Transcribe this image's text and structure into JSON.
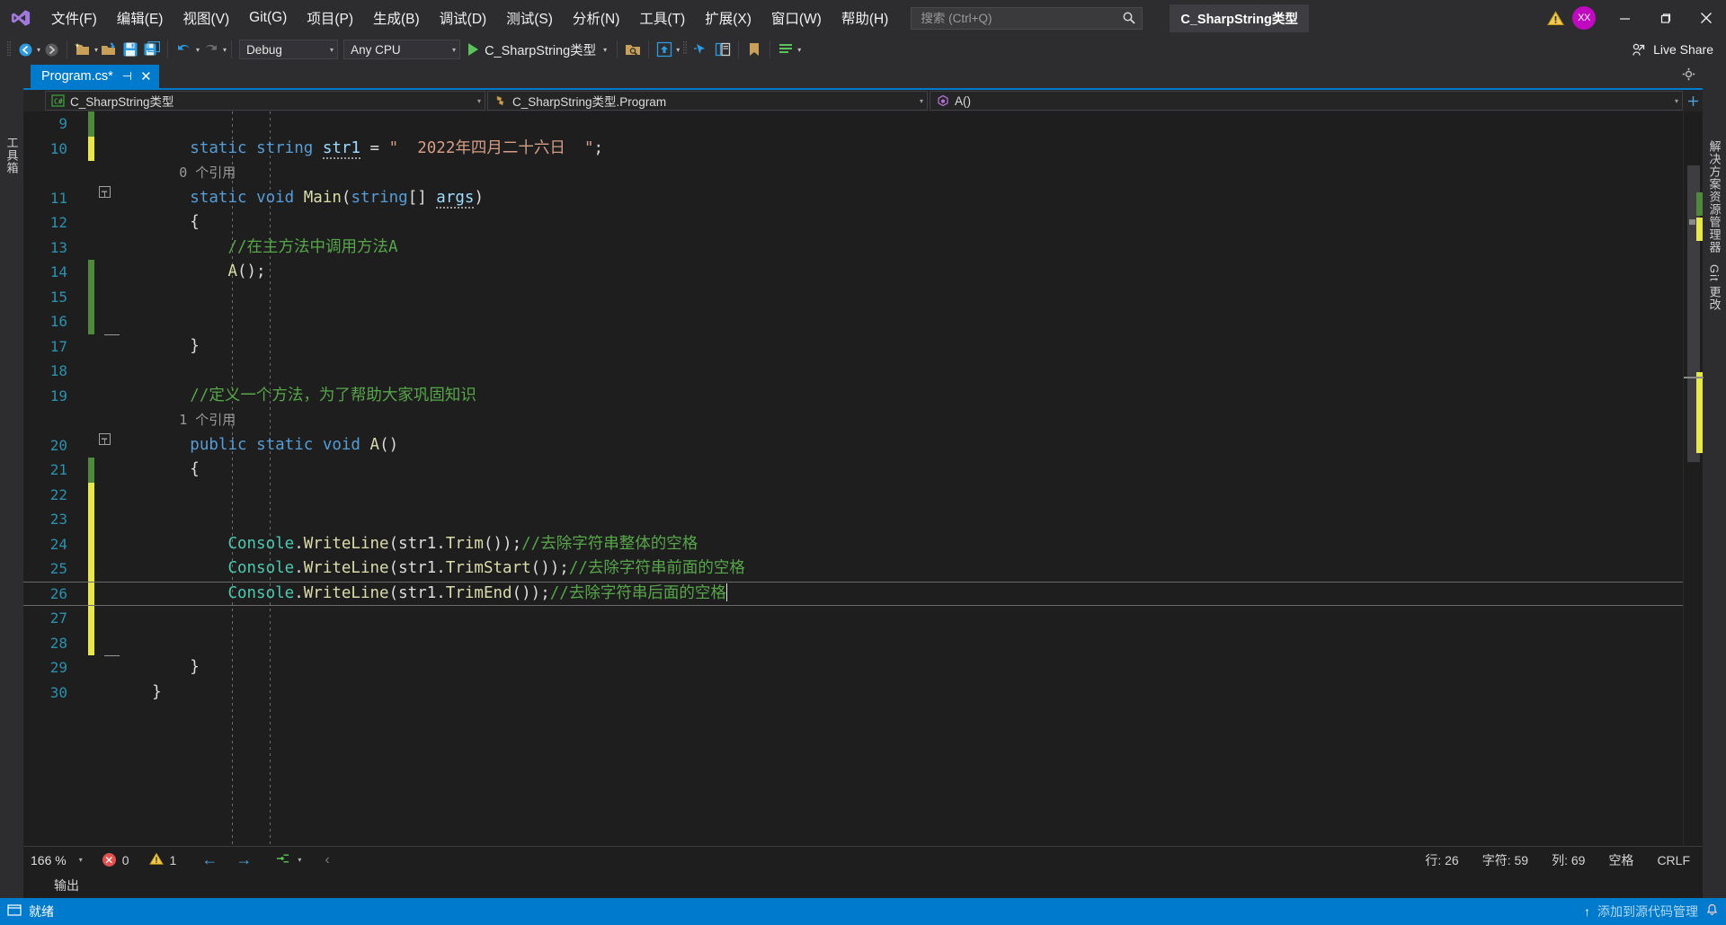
{
  "window": {
    "title": "C_SharpString类型",
    "avatar_initials": "XX",
    "minimize": "—",
    "maximize": "❐",
    "close": "✕"
  },
  "menu": {
    "items": [
      {
        "label": "文件(F)"
      },
      {
        "label": "编辑(E)"
      },
      {
        "label": "视图(V)"
      },
      {
        "label": "Git(G)"
      },
      {
        "label": "项目(P)"
      },
      {
        "label": "生成(B)"
      },
      {
        "label": "调试(D)"
      },
      {
        "label": "测试(S)"
      },
      {
        "label": "分析(N)"
      },
      {
        "label": "工具(T)"
      },
      {
        "label": "扩展(X)"
      },
      {
        "label": "窗口(W)"
      },
      {
        "label": "帮助(H)"
      }
    ],
    "search_placeholder": "搜索 (Ctrl+Q)",
    "search_value": ""
  },
  "toolbar": {
    "configuration": "Debug",
    "platform": "Any CPU",
    "run_target": "C_SharpString类型",
    "live_share": "Live Share"
  },
  "tabs": [
    {
      "label": "Program.cs*",
      "pin": "⊣",
      "close": "✕",
      "active": true
    }
  ],
  "navbar": {
    "project": "C_SharpString类型",
    "class": "C_SharpString类型.Program",
    "member": "A()"
  },
  "rails": {
    "left_label": "工具箱",
    "right_label_1": "解决方案资源管理器",
    "right_label_2": "Git 更改"
  },
  "editor": {
    "lines": [
      {
        "num": "9",
        "change": "green",
        "fold": "none",
        "tokens": []
      },
      {
        "num": "10",
        "change": "yellow",
        "fold": "none",
        "tokens": [
          {
            "t": "        ",
            "c": "plain"
          },
          {
            "t": "static",
            "c": "kw"
          },
          {
            "t": " ",
            "c": "plain"
          },
          {
            "t": "string",
            "c": "kw"
          },
          {
            "t": " ",
            "c": "plain"
          },
          {
            "t": "str1",
            "c": "var-squiggle"
          },
          {
            "t": " ",
            "c": "plain"
          },
          {
            "t": "=",
            "c": "punct"
          },
          {
            "t": " ",
            "c": "plain"
          },
          {
            "t": "\"  2022年四月二十六日  \"",
            "c": "str"
          },
          {
            "t": ";",
            "c": "punct"
          }
        ]
      },
      {
        "num": "",
        "change": "none",
        "fold": "none",
        "codelens": "0 个引用"
      },
      {
        "num": "11",
        "change": "none",
        "fold": "collapse",
        "tokens": [
          {
            "t": "        ",
            "c": "plain"
          },
          {
            "t": "static",
            "c": "kw"
          },
          {
            "t": " ",
            "c": "plain"
          },
          {
            "t": "void",
            "c": "kw"
          },
          {
            "t": " ",
            "c": "plain"
          },
          {
            "t": "Main",
            "c": "fn"
          },
          {
            "t": "(",
            "c": "punct"
          },
          {
            "t": "string",
            "c": "kw"
          },
          {
            "t": "[] ",
            "c": "punct"
          },
          {
            "t": "args",
            "c": "var-squiggle"
          },
          {
            "t": ")",
            "c": "punct"
          }
        ]
      },
      {
        "num": "12",
        "change": "none",
        "fold": "line",
        "tokens": [
          {
            "t": "        {",
            "c": "punct"
          }
        ]
      },
      {
        "num": "13",
        "change": "none",
        "fold": "line",
        "tokens": [
          {
            "t": "            ",
            "c": "plain"
          },
          {
            "t": "//在主方法中调用方法A",
            "c": "cmt"
          }
        ]
      },
      {
        "num": "14",
        "change": "green",
        "fold": "line",
        "tokens": [
          {
            "t": "            ",
            "c": "plain"
          },
          {
            "t": "A",
            "c": "fn"
          },
          {
            "t": "();",
            "c": "punct"
          }
        ]
      },
      {
        "num": "15",
        "change": "green",
        "fold": "line",
        "tokens": []
      },
      {
        "num": "16",
        "change": "green",
        "fold": "line",
        "tokens": []
      },
      {
        "num": "17",
        "change": "none",
        "fold": "end",
        "tokens": [
          {
            "t": "        }",
            "c": "punct"
          }
        ]
      },
      {
        "num": "18",
        "change": "none",
        "fold": "none",
        "tokens": []
      },
      {
        "num": "19",
        "change": "none",
        "fold": "none",
        "tokens": [
          {
            "t": "        ",
            "c": "plain"
          },
          {
            "t": "//定义一个方法，为了帮助大家巩固知识",
            "c": "cmt"
          }
        ]
      },
      {
        "num": "",
        "change": "none",
        "fold": "none",
        "codelens": "1 个引用"
      },
      {
        "num": "20",
        "change": "none",
        "fold": "collapse",
        "tokens": [
          {
            "t": "        ",
            "c": "plain"
          },
          {
            "t": "public",
            "c": "kw"
          },
          {
            "t": " ",
            "c": "plain"
          },
          {
            "t": "static",
            "c": "kw"
          },
          {
            "t": " ",
            "c": "plain"
          },
          {
            "t": "void",
            "c": "kw"
          },
          {
            "t": " ",
            "c": "plain"
          },
          {
            "t": "A",
            "c": "fn"
          },
          {
            "t": "()",
            "c": "punct"
          }
        ]
      },
      {
        "num": "21",
        "change": "green",
        "fold": "line",
        "tokens": [
          {
            "t": "        {",
            "c": "punct"
          }
        ]
      },
      {
        "num": "22",
        "change": "yellow",
        "fold": "line",
        "tokens": []
      },
      {
        "num": "23",
        "change": "yellow",
        "fold": "line",
        "tokens": []
      },
      {
        "num": "24",
        "change": "yellow",
        "fold": "line",
        "tokens": [
          {
            "t": "            ",
            "c": "plain"
          },
          {
            "t": "Console",
            "c": "type"
          },
          {
            "t": ".",
            "c": "punct"
          },
          {
            "t": "WriteLine",
            "c": "fn"
          },
          {
            "t": "(",
            "c": "punct"
          },
          {
            "t": "str1",
            "c": "plain"
          },
          {
            "t": ".",
            "c": "punct"
          },
          {
            "t": "Trim",
            "c": "fn"
          },
          {
            "t": "());",
            "c": "punct"
          },
          {
            "t": "//去除字符串整体的空格",
            "c": "cmt"
          }
        ]
      },
      {
        "num": "25",
        "change": "yellow",
        "fold": "line",
        "tokens": [
          {
            "t": "            ",
            "c": "plain"
          },
          {
            "t": "Console",
            "c": "type"
          },
          {
            "t": ".",
            "c": "punct"
          },
          {
            "t": "WriteLine",
            "c": "fn"
          },
          {
            "t": "(",
            "c": "punct"
          },
          {
            "t": "str1",
            "c": "plain"
          },
          {
            "t": ".",
            "c": "punct"
          },
          {
            "t": "TrimStart",
            "c": "fn"
          },
          {
            "t": "());",
            "c": "punct"
          },
          {
            "t": "//去除字符串前面的空格",
            "c": "cmt"
          }
        ]
      },
      {
        "num": "26",
        "change": "yellow",
        "fold": "line",
        "current": true,
        "tokens": [
          {
            "t": "            ",
            "c": "plain"
          },
          {
            "t": "Console",
            "c": "type"
          },
          {
            "t": ".",
            "c": "punct"
          },
          {
            "t": "WriteLine",
            "c": "fn"
          },
          {
            "t": "(",
            "c": "punct"
          },
          {
            "t": "str1",
            "c": "plain"
          },
          {
            "t": ".",
            "c": "punct"
          },
          {
            "t": "TrimEnd",
            "c": "fn"
          },
          {
            "t": "());",
            "c": "punct"
          },
          {
            "t": "//去除字符串后面的空格",
            "c": "cmt"
          }
        ]
      },
      {
        "num": "27",
        "change": "yellow",
        "fold": "line",
        "tokens": []
      },
      {
        "num": "28",
        "change": "yellow",
        "fold": "line",
        "tokens": []
      },
      {
        "num": "29",
        "change": "none",
        "fold": "end",
        "tokens": [
          {
            "t": "        }",
            "c": "punct"
          }
        ]
      },
      {
        "num": "30",
        "change": "none",
        "fold": "none",
        "tokens": [
          {
            "t": "    }",
            "c": "punct"
          }
        ]
      }
    ]
  },
  "editor_status": {
    "zoom": "166 %",
    "error_count": "0",
    "warning_count": "1",
    "row": "行: 26",
    "chars": "字符: 59",
    "col": "列: 69",
    "spaces": "空格",
    "eol": "CRLF"
  },
  "output": {
    "label": "输出"
  },
  "statusbar": {
    "ready": "就绪",
    "watermark": "添加到源代码管理"
  }
}
